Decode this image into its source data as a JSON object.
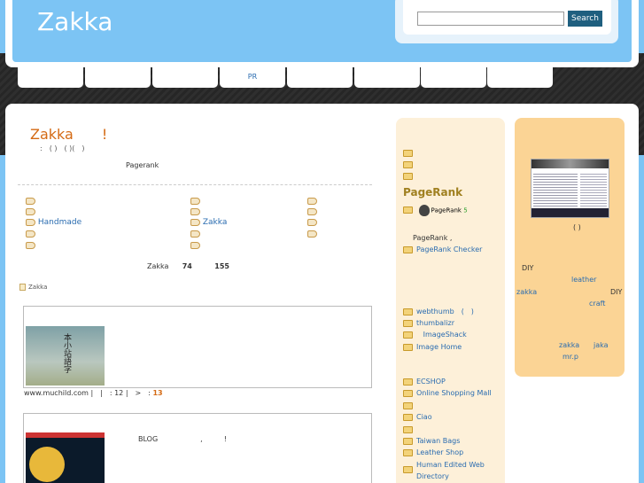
{
  "header": {
    "site_title": "Zakka",
    "search_placeholder": "",
    "search_button": "Search"
  },
  "nav": {
    "tabs": [
      "",
      "",
      "",
      "PR",
      "",
      "",
      "",
      ""
    ]
  },
  "post": {
    "title": "Zakka　　!",
    "meta": ":　( )　( )(　)",
    "pagerank_line": "Pagerank",
    "tags_col1": [
      "",
      "",
      "Handmade",
      "",
      ""
    ],
    "tags_col2": [
      "",
      "",
      "Zakka",
      "",
      ""
    ],
    "tags_col3": [
      "",
      "",
      "",
      ""
    ],
    "stats_prefix": "Zakka",
    "stats_a": "74",
    "stats_b": "155",
    "breadcrumb": "Zakka"
  },
  "entries": [
    {
      "source": "www.muchild.com |　|　: 12 |　>　:",
      "count": "13",
      "thumb_char": "本小站語字"
    },
    {
      "text": "BLOG　　　　　　,　　　!"
    }
  ],
  "sidebar1": {
    "top_items": [
      "",
      "",
      ""
    ],
    "title": "PageRank",
    "badge_label": "PageRank",
    "badge_value": "5",
    "desc": "PageRank ,",
    "checker": "PageRank Checker",
    "items_a": [
      "webthumb　(　)",
      "thumbalizr",
      "ImageShack",
      "Image Home"
    ],
    "items_b": [
      "ECSHOP",
      "Online Shopping Mall",
      "",
      "Ciao",
      "",
      "Taiwan Bags",
      "Leather Shop",
      "Human Edited Web",
      "Directory"
    ]
  },
  "sidebar2": {
    "caption": "( )",
    "words": {
      "diy1": "DIY",
      "leather": "leather",
      "zakka": "zakka",
      "diy2": "DIY",
      "craft": "craft",
      "zakka2": "zakka",
      "jaka": "jaka",
      "mrp": "mr.p"
    }
  },
  "colors": {
    "accent": "#d46a14",
    "link": "#2a6cb0",
    "sky": "#7cc4f4",
    "sidebar_light": "#fdf0d9",
    "sidebar_dark": "#fbd495"
  }
}
